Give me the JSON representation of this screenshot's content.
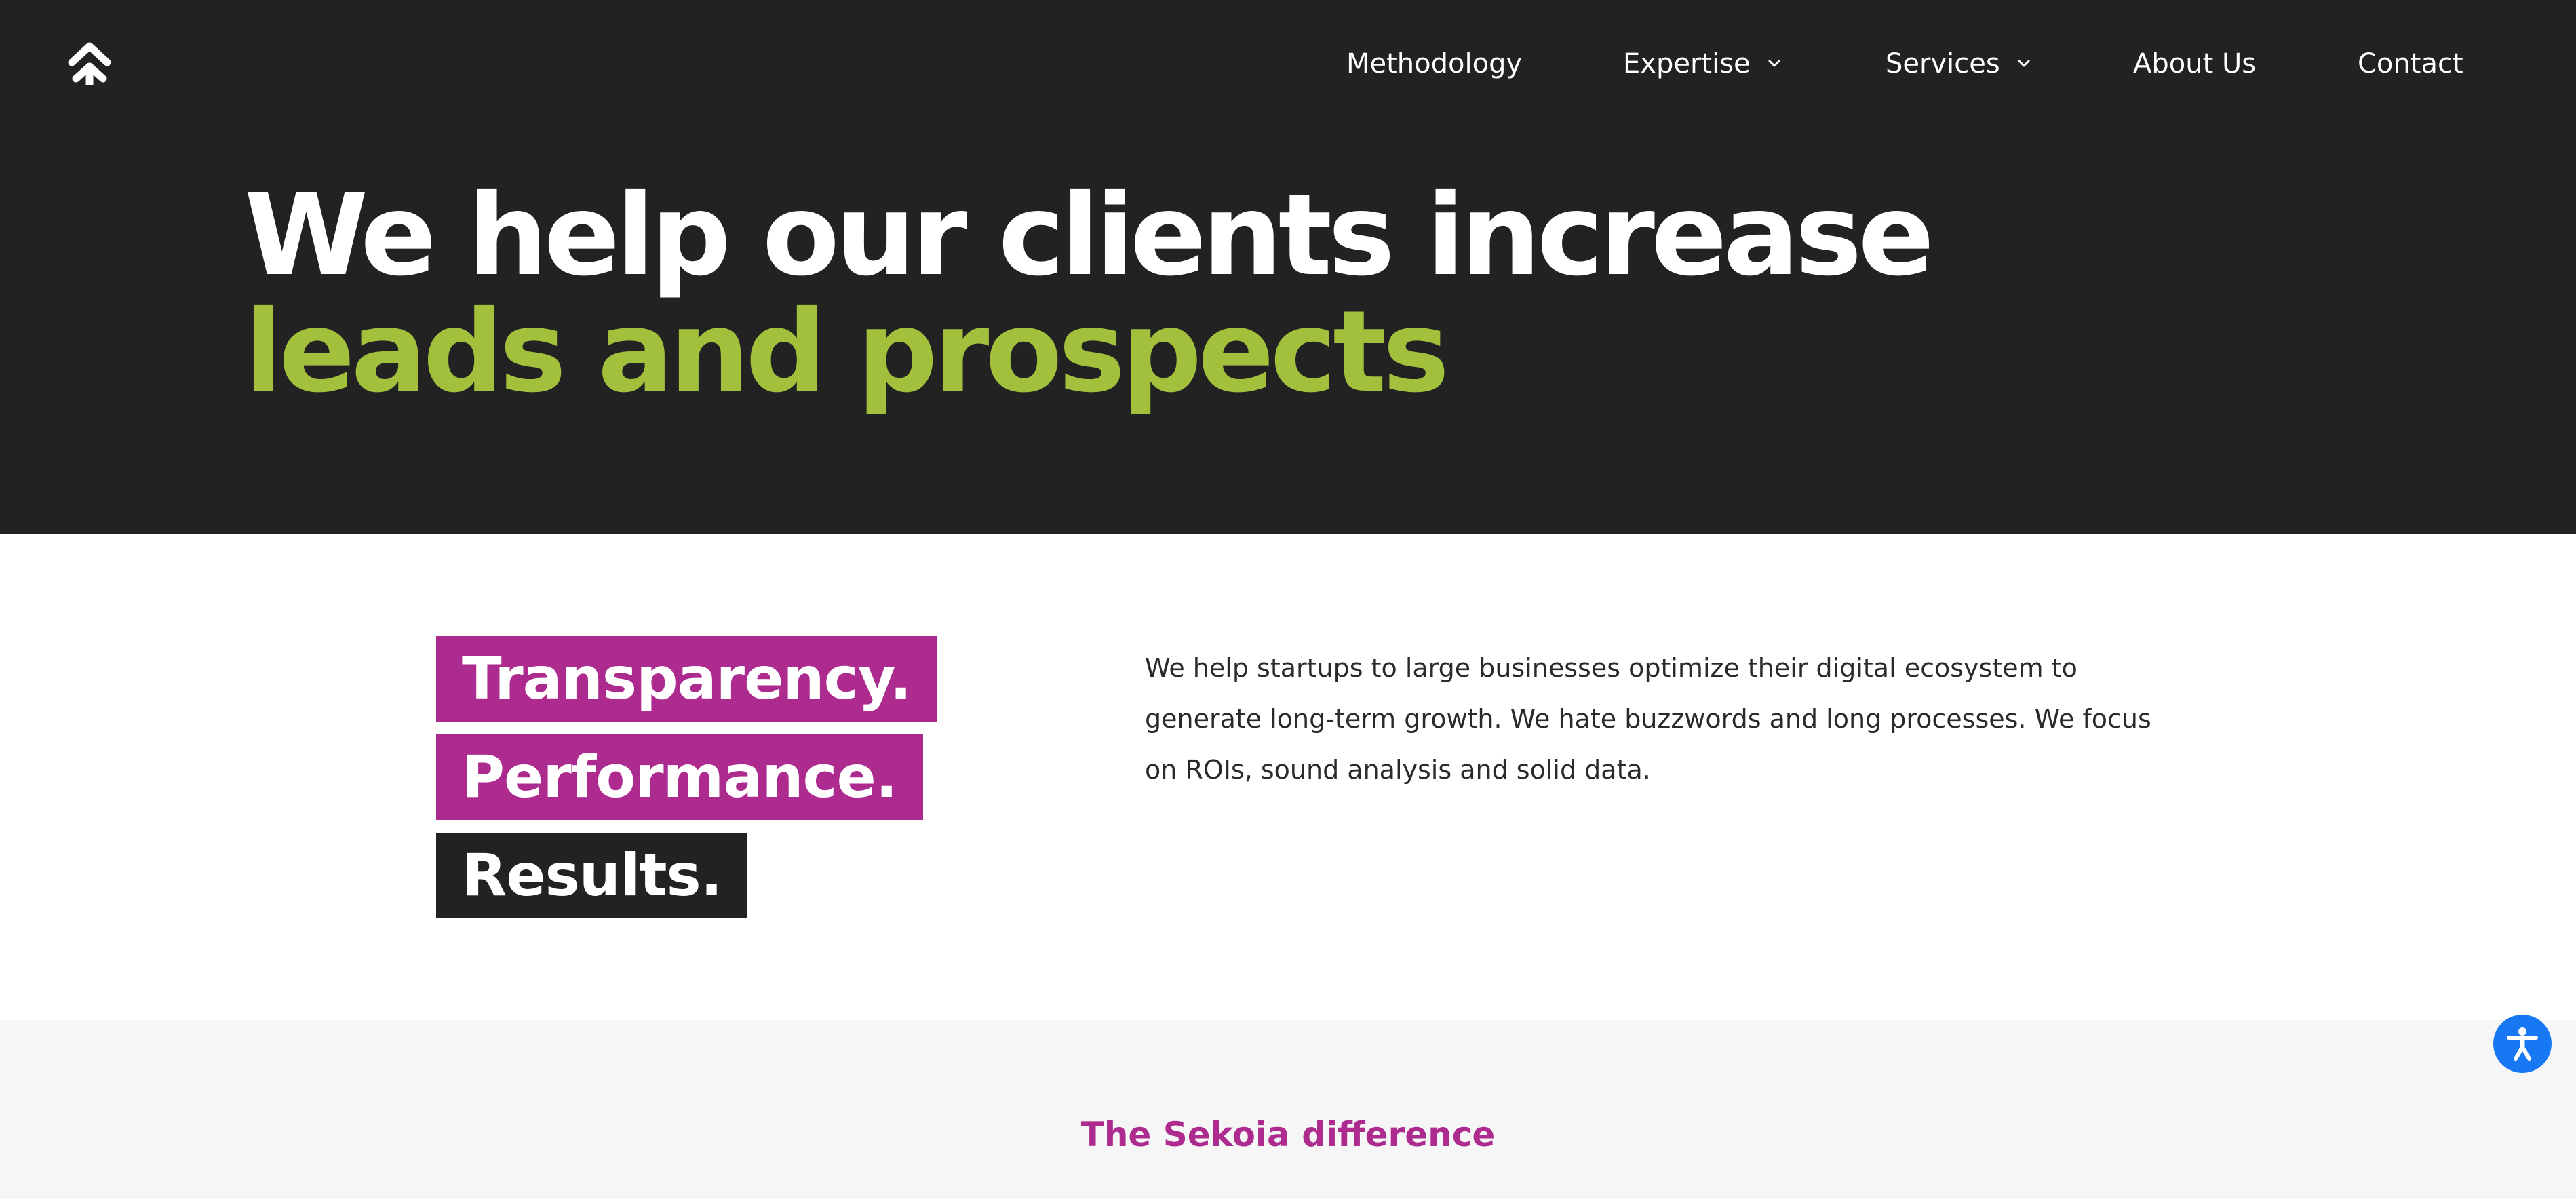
{
  "nav": {
    "items": [
      {
        "label": "Methodology",
        "dropdown": false
      },
      {
        "label": "Expertise",
        "dropdown": true
      },
      {
        "label": "Services",
        "dropdown": true
      },
      {
        "label": "About Us",
        "dropdown": false
      },
      {
        "label": "Contact",
        "dropdown": false
      }
    ]
  },
  "hero": {
    "line1": "We help our clients increase",
    "line2": "leads and prospects"
  },
  "values": {
    "tags": [
      "Transparency.",
      "Performance.",
      "Results."
    ],
    "intro": "We help startups to large businesses optimize their digital ecosystem to generate long-term growth. We hate buzzwords and long processes. We focus on ROIs, sound analysis and solid data."
  },
  "difference": {
    "title": "The Sekoia difference"
  },
  "colors": {
    "dark_bg": "#222222",
    "accent_green": "#a2c03b",
    "accent_magenta": "#ad2a8f",
    "section_grey": "#f6f6f6",
    "a11y_blue": "#1877f2"
  },
  "icons": {
    "logo": "double-chevron-up-icon",
    "dropdown": "chevron-down-icon",
    "accessibility": "accessibility-icon"
  }
}
